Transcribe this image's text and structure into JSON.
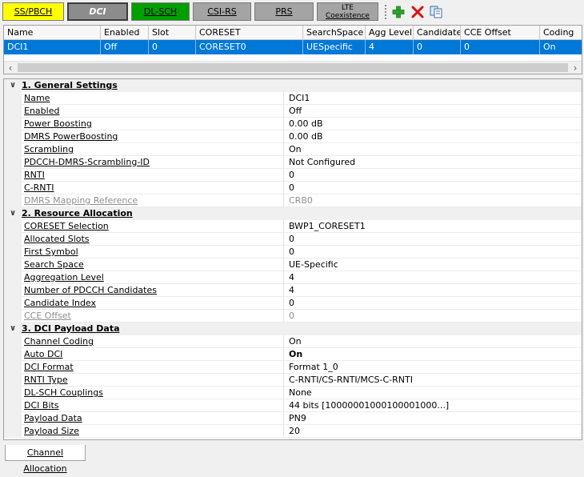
{
  "toolbar": {
    "buttons": {
      "ss_pbch": "SS/PBCH",
      "dci": "DCI",
      "dl_sch": "DL-SCH",
      "csi_rs": "CSI-RS",
      "prs": "PRS",
      "lte_line1": "LTE",
      "lte_line2": "Coexistence"
    },
    "icons": [
      "add-icon",
      "delete-icon",
      "copy-icon"
    ]
  },
  "grid": {
    "columns": [
      "Name",
      "Enabled",
      "Slot",
      "CORESET",
      "SearchSpace",
      "Agg Level",
      "Candidate",
      "CCE Offset",
      "Coding"
    ],
    "rows": [
      [
        "DCI1",
        "Off",
        "0",
        "CORESET0",
        "UESpecific",
        "4",
        "0",
        "0",
        "On"
      ]
    ]
  },
  "properties": {
    "general": {
      "title": "1. General Settings",
      "items": [
        {
          "name": "Name",
          "value": "DCI1"
        },
        {
          "name": "Enabled",
          "value": "Off"
        },
        {
          "name": "Power Boosting",
          "value": "0.00 dB"
        },
        {
          "name": "DMRS PowerBoosting",
          "value": "0.00 dB"
        },
        {
          "name": "Scrambling",
          "value": "On"
        },
        {
          "name": "PDCCH-DMRS-Scrambling-ID",
          "value": "Not Configured"
        },
        {
          "name": "RNTI",
          "value": "0"
        },
        {
          "name": "C-RNTI",
          "value": "0"
        },
        {
          "name": "DMRS Mapping Reference",
          "value": "CRB0"
        }
      ]
    },
    "resource": {
      "title": "2. Resource Allocation",
      "items": [
        {
          "name": "CORESET Selection",
          "value": "BWP1_CORESET1"
        },
        {
          "name": "Allocated Slots",
          "value": "0"
        },
        {
          "name": "First Symbol",
          "value": "0"
        },
        {
          "name": "Search Space",
          "value": "UE-Specific"
        },
        {
          "name": "Aggregation Level",
          "value": "4"
        },
        {
          "name": "Number of PDCCH Candidates",
          "value": "4"
        },
        {
          "name": "Candidate Index",
          "value": "0"
        },
        {
          "name": "CCE Offset",
          "value": "0"
        }
      ]
    },
    "payload": {
      "title": "3. DCI Payload Data",
      "items": [
        {
          "name": "Channel Coding",
          "value": "On"
        },
        {
          "name": "Auto DCI",
          "value": "On"
        },
        {
          "name": "DCI Format",
          "value": "Format 1_0"
        },
        {
          "name": "RNTI Type",
          "value": "C-RNTI/CS-RNTI/MCS-C-RNTI"
        },
        {
          "name": "DL-SCH Couplings",
          "value": "None"
        },
        {
          "name": "DCI Bits",
          "value": "44 bits [10000001000100001000...]"
        },
        {
          "name": "Payload Data",
          "value": "PN9"
        },
        {
          "name": "Payload Size",
          "value": "20"
        }
      ]
    }
  },
  "bottom_tabs": [
    "Channel Allocation"
  ],
  "colors": {
    "ss_pbch": "#ffff00",
    "dci": "#8c8c8c",
    "dl_sch": "#00a000",
    "inactive_tab": "#a4a4a4",
    "selection": "#0078d7",
    "add": "#2ea32e",
    "delete": "#e01010"
  }
}
